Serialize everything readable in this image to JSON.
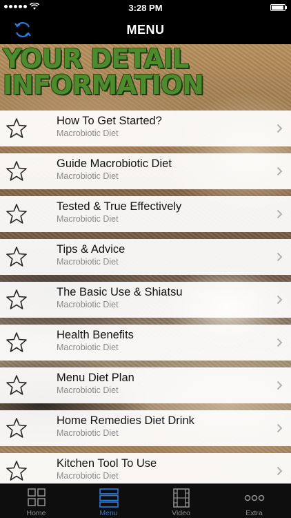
{
  "status_bar": {
    "time": "3:28 PM",
    "battery_level": 0.95
  },
  "nav": {
    "title": "MENU"
  },
  "header": {
    "line1": "YOUR DETAIL",
    "line2": "INFORMATION"
  },
  "menu": {
    "items": [
      {
        "title": "How To Get Started?",
        "subtitle": "Macrobiotic Diet"
      },
      {
        "title": "Guide Macrobiotic Diet",
        "subtitle": "Macrobiotic Diet"
      },
      {
        "title": "Tested & True Effectively",
        "subtitle": "Macrobiotic Diet"
      },
      {
        "title": "Tips & Advice",
        "subtitle": "Macrobiotic Diet"
      },
      {
        "title": "The Basic Use & Shiatsu",
        "subtitle": "Macrobiotic Diet"
      },
      {
        "title": "Health Benefits",
        "subtitle": "Macrobiotic Diet"
      },
      {
        "title": "Menu Diet Plan",
        "subtitle": "Macrobiotic Diet"
      },
      {
        "title": "Home Remedies Diet Drink",
        "subtitle": "Macrobiotic Diet"
      },
      {
        "title": "Kitchen Tool To Use",
        "subtitle": "Macrobiotic Diet"
      }
    ]
  },
  "tabs": [
    {
      "label": "Home",
      "icon": "grid-icon"
    },
    {
      "label": "Menu",
      "icon": "list-icon"
    },
    {
      "label": "Video",
      "icon": "film-icon"
    },
    {
      "label": "Extra",
      "icon": "more-icon"
    }
  ],
  "colors": {
    "accent": "#2a7de1",
    "header_green": "#4e8a2e",
    "tab_inactive": "#8e8e8e"
  }
}
